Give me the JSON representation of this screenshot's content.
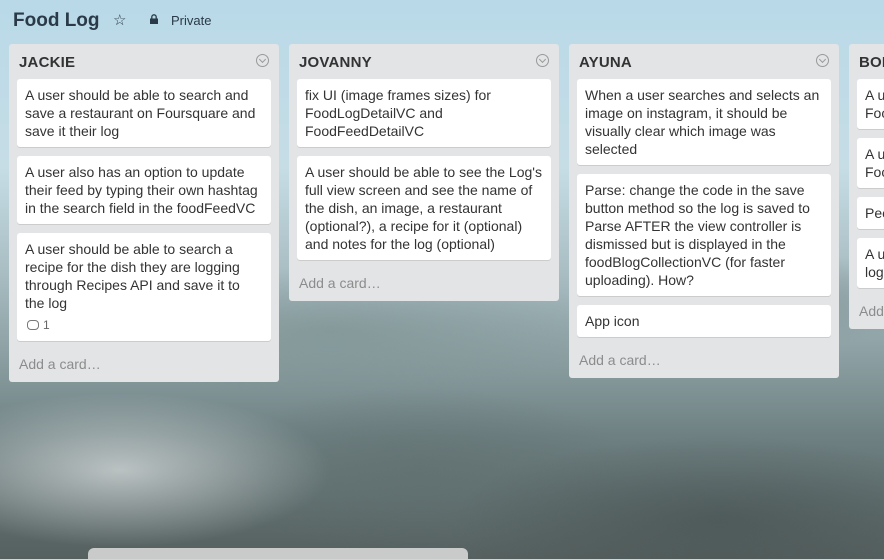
{
  "board": {
    "title": "Food Log",
    "privacy": "Private"
  },
  "lists": [
    {
      "name": "JACKIE",
      "cards": [
        {
          "text": "A user should be able to search and save a restaurant on Foursquare and save it their log"
        },
        {
          "text": "A user also has an option to update their feed by typing their own hashtag in the search field in the foodFeedVC"
        },
        {
          "text": "A user should be able to search a recipe for the dish they are logging through Recipes API and save it to the log",
          "comments": "1"
        }
      ],
      "add_card": "Add a card…"
    },
    {
      "name": "JOVANNY",
      "cards": [
        {
          "text": "fix UI (image frames sizes) for FoodLogDetailVC and FoodFeedDetailVC"
        },
        {
          "text": "A user should be able to see the Log's full view screen and see the name of the dish, an image, a restaurant (optional?), a recipe for it (optional) and notes for the log (optional)"
        }
      ],
      "add_card": "Add a card…"
    },
    {
      "name": "AYUNA",
      "cards": [
        {
          "text": "When a user searches and selects an image on instagram, it should be visually clear which image was selected"
        },
        {
          "text": "Parse: change the code in the save button method so the log is saved to Parse AFTER the view controller is dismissed but is displayed in the foodBlogCollectionVC (for faster uploading). How?"
        },
        {
          "text": "App icon"
        }
      ],
      "add_card": "Add a card…"
    },
    {
      "name": "BOB",
      "cards": [
        {
          "text": "A u Foo"
        },
        {
          "text": "A u Foo"
        },
        {
          "text": "Pee"
        },
        {
          "text": "A u log"
        }
      ],
      "add_card": "Add"
    }
  ]
}
